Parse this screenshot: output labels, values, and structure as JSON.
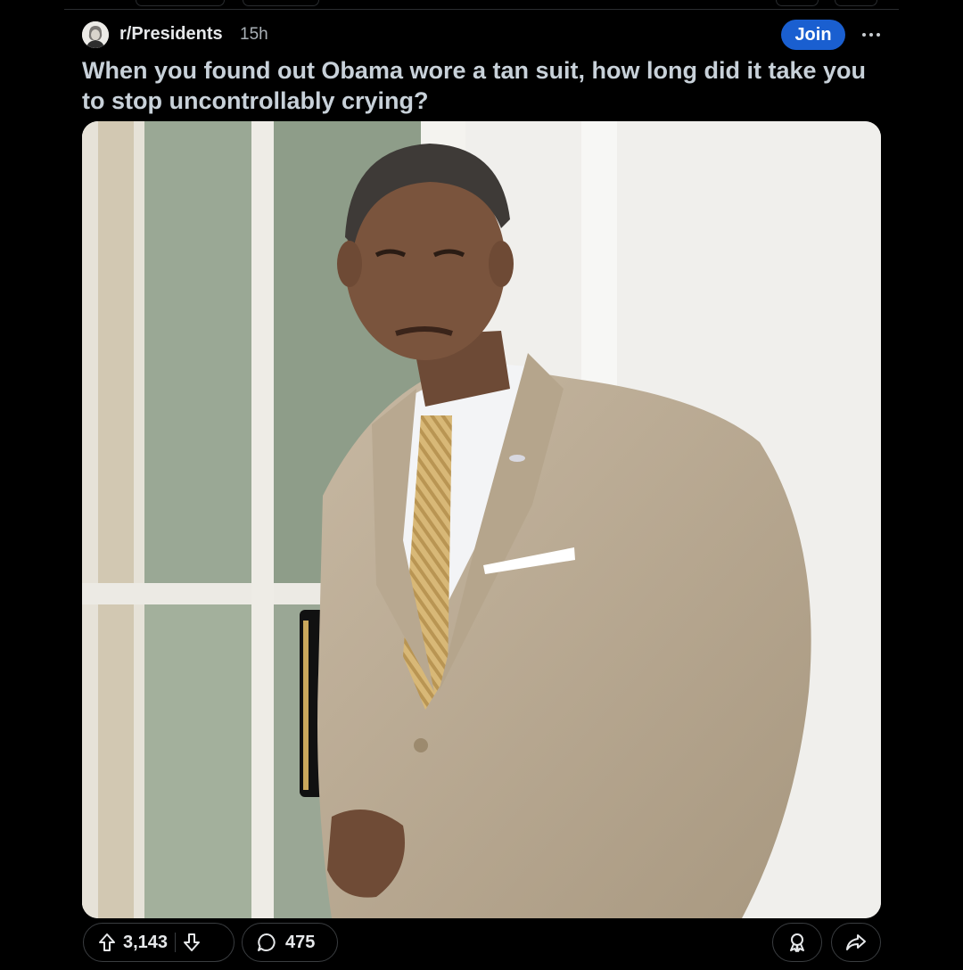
{
  "post": {
    "subreddit": "r/Presidents",
    "age": "15h",
    "join_label": "Join",
    "title": "When you found out Obama wore a tan suit, how long did it take you to stop uncontrollably crying?",
    "image_icon": "photo-of-man-in-tan-suit"
  },
  "actions": {
    "upvotes": "3,143",
    "comments": "475",
    "upvote_icon": "arrow-up-icon",
    "downvote_icon": "arrow-down-icon",
    "comment_icon": "speech-bubble-icon",
    "award_icon": "award-icon",
    "share_icon": "share-icon"
  },
  "colors": {
    "background": "#000000",
    "join_button": "#1a5fd0",
    "title_text": "#c8d1d9",
    "border": "#3a3d40"
  }
}
